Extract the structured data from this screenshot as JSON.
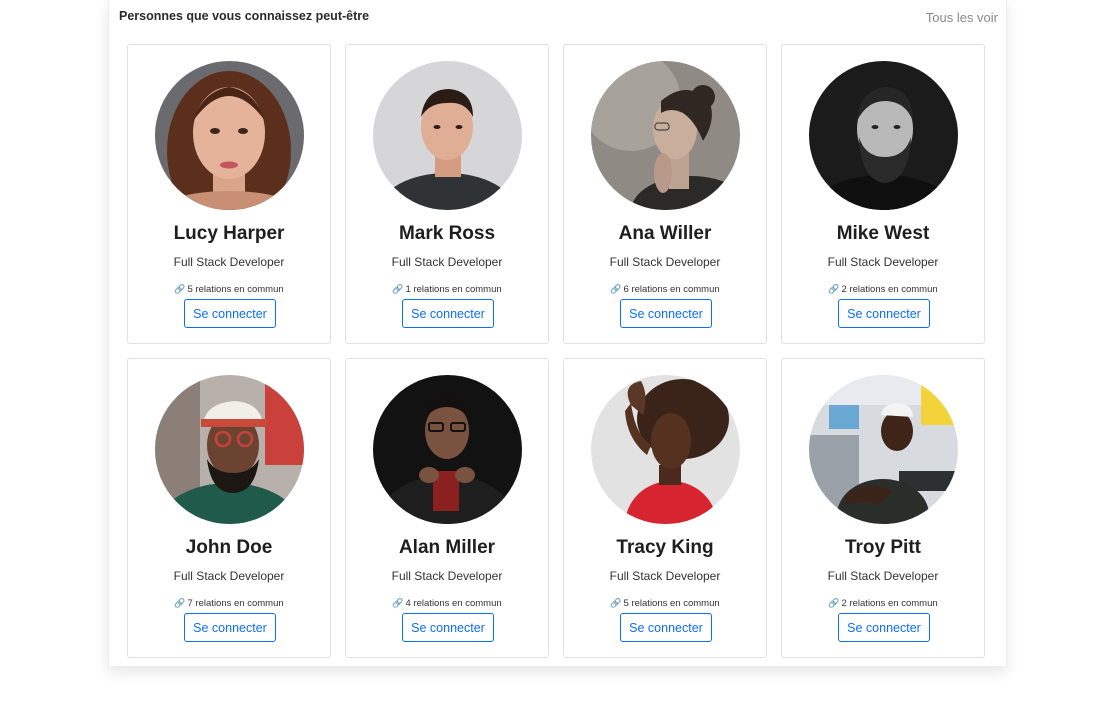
{
  "section": {
    "title": "Personnes que vous connaissez peut-être",
    "see_all": "Tous les voir"
  },
  "cards": [
    {
      "name": "Lucy Harper",
      "role": "Full Stack Developer",
      "mutual": "5 relations en commun",
      "button": "Se connecter",
      "photo": "woman-long-brown-hair-portrait"
    },
    {
      "name": "Mark Ross",
      "role": "Full Stack Developer",
      "mutual": "1 relations en commun",
      "button": "Se connecter",
      "photo": "young-man-dark-shirt-portrait"
    },
    {
      "name": "Ana Willer",
      "role": "Full Stack Developer",
      "mutual": "6 relations en commun",
      "button": "Se connecter",
      "photo": "woman-glasses-sepia-profile"
    },
    {
      "name": "Mike West",
      "role": "Full Stack Developer",
      "mutual": "2 relations en commun",
      "button": "Se connecter",
      "photo": "bearded-man-black-and-white"
    },
    {
      "name": "John Doe",
      "role": "Full Stack Developer",
      "mutual": "7 relations en commun",
      "button": "Se connecter",
      "photo": "bearded-man-cap-green-hoodie"
    },
    {
      "name": "Alan Miller",
      "role": "Full Stack Developer",
      "mutual": "4 relations en commun",
      "button": "Se connecter",
      "photo": "man-glasses-black-hoodie"
    },
    {
      "name": "Tracy King",
      "role": "Full Stack Developer",
      "mutual": "5 relations en commun",
      "button": "Se connecter",
      "photo": "woman-curly-hair-red-top"
    },
    {
      "name": "Troy Pitt",
      "role": "Full Stack Developer",
      "mutual": "2 relations en commun",
      "button": "Se connecter",
      "photo": "young-man-white-cap-office"
    }
  ],
  "colors": {
    "accent": "#0d6efd",
    "card_border": "#dfe1e4"
  }
}
